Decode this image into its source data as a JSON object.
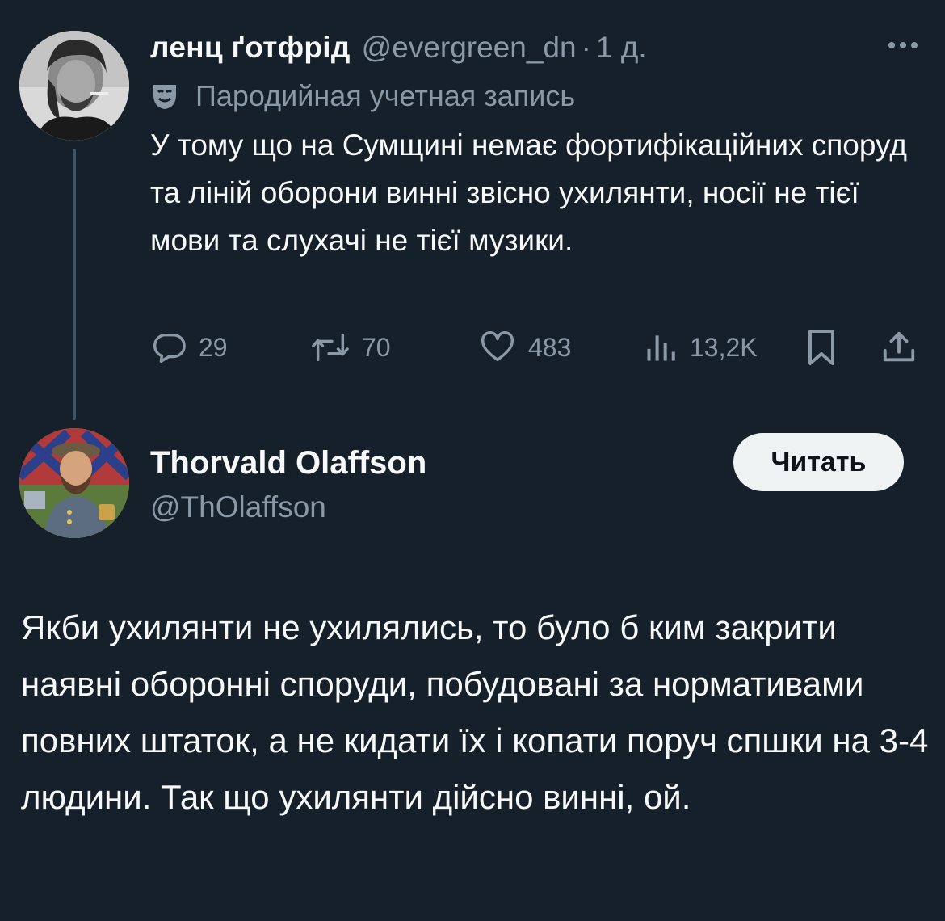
{
  "tweet1": {
    "display_name": "ленц ґотфрід",
    "handle": "@evergreen_dn",
    "separator": "·",
    "time": "1 д.",
    "parody_label": "Пародийная учетная запись",
    "text": "У тому що на Сумщині немає фортифікаційних споруд та ліній оборони винні звісно ухилянти, носії не тієї мови та слухачі не тієї музики.",
    "actions": {
      "replies": "29",
      "reposts": "70",
      "likes": "483",
      "views": "13,2K"
    }
  },
  "tweet2": {
    "display_name": "Thorvald Olaffson",
    "handle": "@ThOlaffson",
    "follow_label": "Читать",
    "text": "Якби ухилянти не ухилялись, то було б ким закрити наявні оборонні споруди, побудовані за нормативами повних штаток, а не кидати їх і копати поруч спшки на 3-4 людини. Так що ухилянти дійсно винні, ой."
  },
  "icons": {
    "more": "more-dots-icon",
    "parody": "theater-mask-icon",
    "reply": "reply-bubble-icon",
    "repost": "repost-arrows-icon",
    "like": "heart-icon",
    "views": "bar-chart-icon",
    "bookmark": "bookmark-icon",
    "share": "share-icon"
  },
  "colors": {
    "background": "#15202b",
    "text_primary": "#f7f9f9",
    "text_secondary": "#8b98a5",
    "thread_line": "#425364",
    "follow_button_bg": "#eff3f4"
  }
}
